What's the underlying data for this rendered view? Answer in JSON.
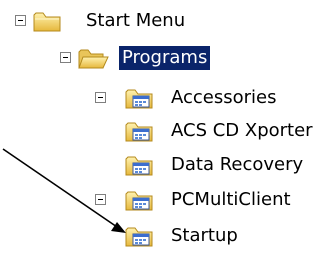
{
  "tree": {
    "items": [
      {
        "label": "Start Menu",
        "icon": "folder-icon",
        "toggle": "minus"
      },
      {
        "label": "Programs",
        "icon": "open-folder-icon",
        "toggle": "minus",
        "selected": true
      },
      {
        "label": "Accessories",
        "icon": "program-group-icon",
        "toggle": "plus"
      },
      {
        "label": "ACS CD Xporter",
        "icon": "program-group-icon",
        "toggle": null
      },
      {
        "label": "Data Recovery",
        "icon": "program-group-icon",
        "toggle": null
      },
      {
        "label": "PCMultiClient",
        "icon": "program-group-icon",
        "toggle": "plus"
      },
      {
        "label": "Startup",
        "icon": "program-group-icon",
        "toggle": null
      }
    ]
  },
  "annotation": {
    "type": "arrow",
    "points_to": "Startup"
  },
  "colors": {
    "folder": "#f2d36b",
    "selection": "#0a246a",
    "arrow": "#000000"
  }
}
